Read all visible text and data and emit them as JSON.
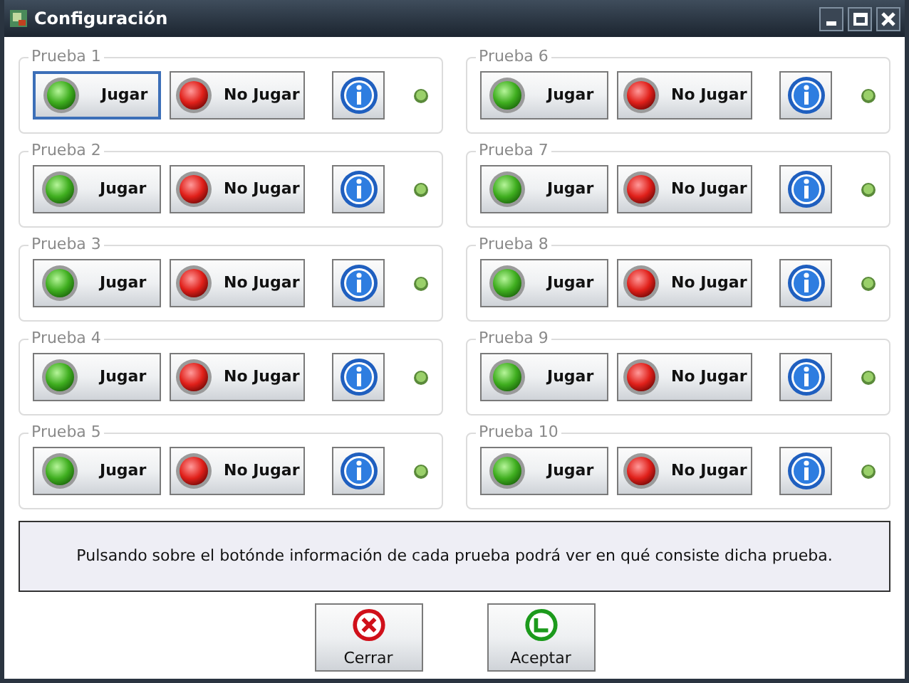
{
  "window": {
    "title": "Configuración"
  },
  "tests": [
    {
      "label": "Prueba 1",
      "play": "Jugar",
      "no_play": "No Jugar",
      "play_focused": true
    },
    {
      "label": "Prueba 2",
      "play": "Jugar",
      "no_play": "No Jugar",
      "play_focused": false
    },
    {
      "label": "Prueba 3",
      "play": "Jugar",
      "no_play": "No Jugar",
      "play_focused": false
    },
    {
      "label": "Prueba 4",
      "play": "Jugar",
      "no_play": "No Jugar",
      "play_focused": false
    },
    {
      "label": "Prueba 5",
      "play": "Jugar",
      "no_play": "No Jugar",
      "play_focused": false
    },
    {
      "label": "Prueba 6",
      "play": "Jugar",
      "no_play": "No Jugar",
      "play_focused": false
    },
    {
      "label": "Prueba 7",
      "play": "Jugar",
      "no_play": "No Jugar",
      "play_focused": false
    },
    {
      "label": "Prueba 8",
      "play": "Jugar",
      "no_play": "No Jugar",
      "play_focused": false
    },
    {
      "label": "Prueba 9",
      "play": "Jugar",
      "no_play": "No Jugar",
      "play_focused": false
    },
    {
      "label": "Prueba 10",
      "play": "Jugar",
      "no_play": "No Jugar",
      "play_focused": false
    }
  ],
  "info_text": "Pulsando sobre el botónde información de cada prueba podrá ver en qué consiste dicha prueba.",
  "buttons": [
    {
      "label": "Cerrar",
      "kind": "close"
    },
    {
      "label": "Aceptar",
      "kind": "accept"
    }
  ]
}
